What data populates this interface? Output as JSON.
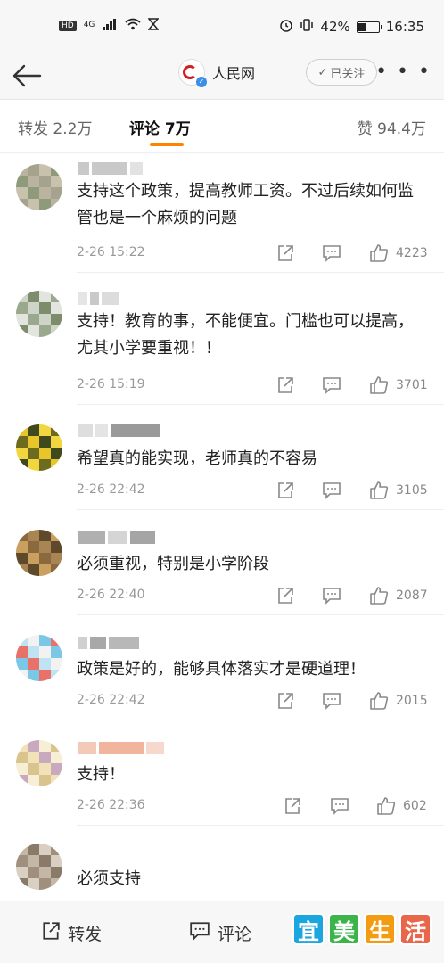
{
  "status_bar": {
    "hd": "HD",
    "network": "4G",
    "battery_percent_text": "42%",
    "battery_level": 0.42,
    "time": "16:35"
  },
  "nav": {
    "account_name": "人民网",
    "follow_label": "已关注",
    "more_label": "• • •"
  },
  "tabs": {
    "repost": "转发 2.2万",
    "comment": "评论 7万",
    "like": "赞 94.4万"
  },
  "comments": [
    {
      "text": "支持这个政策，提高教师工资。不过后续如何监管也是一个麻烦的问题",
      "time": "2-26 15:22",
      "likes": "4223",
      "avatar_colors": [
        "#b9b3a0",
        "#8f9a7b",
        "#c8c2ad",
        "#a5a28e"
      ]
    },
    {
      "text": "支持！教育的事，不能便宜。门槛也可以提高，尤其小学要重视！！",
      "time": "2-26 15:19",
      "likes": "3701",
      "avatar_colors": [
        "#cfd4c8",
        "#9aa88d",
        "#e2e4de",
        "#7d8d6c"
      ]
    },
    {
      "text": "希望真的能实现，老师真的不容易",
      "time": "2-26 22:42",
      "likes": "3105",
      "avatar_colors": [
        "#e8c52a",
        "#6d6b1e",
        "#f2d640",
        "#3f4a1c"
      ]
    },
    {
      "text": "必须重视，特别是小学阶段",
      "time": "2-26 22:40",
      "likes": "2087",
      "avatar_colors": [
        "#8a6a3d",
        "#c9a060",
        "#5e4a2b",
        "#a88552"
      ]
    },
    {
      "text": "政策是好的，能够具体落实才是硬道理！",
      "time": "2-26 22:42",
      "likes": "2015",
      "avatar_colors": [
        "#bfe3f2",
        "#e8716a",
        "#7bc7e6",
        "#f2f2f2"
      ]
    },
    {
      "text": "支持！",
      "time": "2-26 22:36",
      "likes": "602",
      "avatar_colors": [
        "#f1e2b8",
        "#d8c48c",
        "#f7eed6",
        "#c9a9c0"
      ]
    },
    {
      "text": "必须支持",
      "time": "",
      "likes": "",
      "avatar_colors": [
        "#c4b7a6",
        "#a08f7d",
        "#d9cfc2",
        "#8a7a69"
      ]
    }
  ],
  "bottom_bar": {
    "repost_label": "转发",
    "comment_label": "评论"
  },
  "watermark": {
    "chars": [
      "宜",
      "美",
      "生",
      "活"
    ],
    "colors": [
      "#1aa7e0",
      "#3bb54a",
      "#f39c12",
      "#e9664a"
    ]
  }
}
